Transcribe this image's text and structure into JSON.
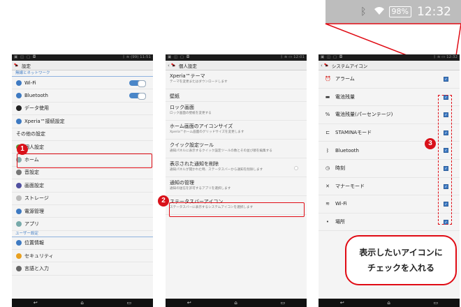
{
  "zoom": {
    "battery": "98%",
    "time": "12:32"
  },
  "screen1": {
    "status_time": "11:51",
    "status_battery": "99",
    "title": "設定",
    "sections": [
      {
        "header": "無線とネットワーク",
        "items": [
          {
            "label": "Wi-Fi",
            "icon": "wifi-icon",
            "toggle": "ON"
          },
          {
            "label": "Bluetooth",
            "icon": "bluetooth-icon",
            "toggle": "ON"
          },
          {
            "label": "データ使用",
            "icon": "data-usage-icon"
          },
          {
            "label": "Xperia™接続設定",
            "icon": "xperia-connect-icon"
          },
          {
            "label": "その他の設定",
            "icon": ""
          }
        ]
      },
      {
        "header": "",
        "items": [
          {
            "label": "個人設定",
            "icon": "personalize-icon"
          },
          {
            "label": "ホーム",
            "icon": "home-icon"
          },
          {
            "label": "音設定",
            "icon": "sound-icon"
          },
          {
            "label": "画面設定",
            "icon": "display-icon"
          },
          {
            "label": "ストレージ",
            "icon": "storage-icon"
          },
          {
            "label": "電源管理",
            "icon": "power-icon"
          },
          {
            "label": "アプリ",
            "icon": "apps-icon"
          }
        ]
      },
      {
        "header": "ユーザー設定",
        "items": [
          {
            "label": "位置情報",
            "icon": "location-icon"
          },
          {
            "label": "セキュリティ",
            "icon": "security-icon"
          },
          {
            "label": "言語と入力",
            "icon": "keyboard-icon"
          }
        ]
      }
    ]
  },
  "screen2": {
    "status_time": "12:01",
    "title": "個人設定",
    "items": [
      {
        "title": "Xperia™テーマ",
        "sub": "テーマを変更またはダウンロードします"
      },
      {
        "title": "壁紙",
        "sub": ""
      },
      {
        "title": "ロック画面",
        "sub": "ロック画面の壁紙を変更する"
      },
      {
        "title": "ホーム画面のアイコンサイズ",
        "sub": "Xperia™ホーム画面のグリッドサイズを変更します"
      },
      {
        "title": "クイック設定ツール",
        "sub": "通知パネルに表示するクイック設定ツールの数とその並び順を編集する"
      },
      {
        "title": "表示された通知を削除",
        "sub": "通知パネルが開かれた時、ステータスバーから通知を削除します"
      },
      {
        "title": "通知の管理",
        "sub": "通知の送信を許可するアプリを選択します"
      },
      {
        "title": "ステータスバーアイコン",
        "sub": "ステータスバーに表示するシステムアイコンを選択します"
      }
    ]
  },
  "screen3": {
    "status_time": "12:32",
    "title": "システムアイコン",
    "items": [
      {
        "label": "アラーム",
        "icon": "alarm-icon",
        "glyph": "⏰"
      },
      {
        "label": "電池残量",
        "icon": "battery-icon",
        "glyph": "▬"
      },
      {
        "label": "電池残量(パーセンテージ)",
        "icon": "percent-icon",
        "glyph": "%"
      },
      {
        "label": "STAMINAモード",
        "icon": "stamina-icon",
        "glyph": "⊏"
      },
      {
        "label": "Bluetooth",
        "icon": "bluetooth-icon",
        "glyph": "ᛒ"
      },
      {
        "label": "時刻",
        "icon": "clock-icon",
        "glyph": "◷"
      },
      {
        "label": "マナーモード",
        "icon": "manner-icon",
        "glyph": "✕"
      },
      {
        "label": "Wi-Fi",
        "icon": "wifi-icon",
        "glyph": "≋"
      },
      {
        "label": "場所",
        "icon": "location-icon",
        "glyph": "•"
      }
    ]
  },
  "badges": [
    "1",
    "2",
    "3"
  ],
  "callout": {
    "line1": "表示したいアイコンに",
    "line2": "チェックを入れる"
  },
  "colors": {
    "accent": "#3e7ac2",
    "highlight": "#e00b14"
  }
}
